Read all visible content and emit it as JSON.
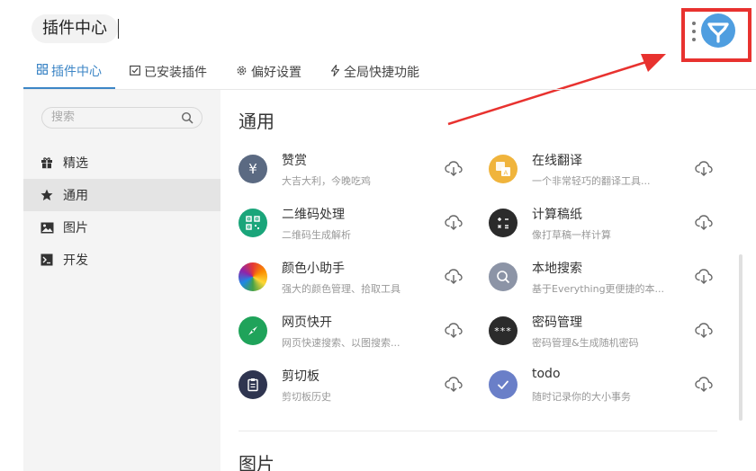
{
  "header": {
    "title": "插件中心"
  },
  "tabs": [
    {
      "icon": "grid-icon",
      "label": "插件中心",
      "active": true
    },
    {
      "icon": "installed-icon",
      "label": "已安装插件",
      "active": false
    },
    {
      "icon": "gear-icon",
      "label": "偏好设置",
      "active": false
    },
    {
      "icon": "lightning-icon",
      "label": "全局快捷功能",
      "active": false
    }
  ],
  "sidebar": {
    "search_placeholder": "搜索",
    "items": [
      {
        "icon": "gift-icon",
        "label": "精选"
      },
      {
        "icon": "star-icon",
        "label": "通用"
      },
      {
        "icon": "image-icon",
        "label": "图片"
      },
      {
        "icon": "terminal-icon",
        "label": "开发"
      }
    ]
  },
  "main": {
    "section_1": "通用",
    "section_2": "图片",
    "plugins": [
      {
        "name": "赞赏",
        "desc": "大吉大利，今晚吃鸡",
        "icon": "yen-icon",
        "color": "#5b6a82",
        "glyph": "¥"
      },
      {
        "name": "在线翻译",
        "desc": "一个非常轻巧的翻译工具...",
        "icon": "translate-icon",
        "color": "#f0b43c",
        "glyph": ""
      },
      {
        "name": "二维码处理",
        "desc": "二维码生成解析",
        "icon": "qrcode-icon",
        "color": "#1aa57a",
        "glyph": ""
      },
      {
        "name": "计算稿纸",
        "desc": "像打草稿一样计算",
        "icon": "calculator-icon",
        "color": "#2b2b2b",
        "glyph": ""
      },
      {
        "name": "颜色小助手",
        "desc": "强大的颜色管理、拾取工具",
        "icon": "color-wheel-icon",
        "color": "#e84040",
        "glyph": ""
      },
      {
        "name": "本地搜索",
        "desc": "基于Everything更便捷的本...",
        "icon": "local-search-icon",
        "color": "#8c94a6",
        "glyph": ""
      },
      {
        "name": "网页快开",
        "desc": "网页快速搜索、以图搜索...",
        "icon": "compass-icon",
        "color": "#1fa35a",
        "glyph": ""
      },
      {
        "name": "密码管理",
        "desc": "密码管理&生成随机密码",
        "icon": "password-icon",
        "color": "#2b2b2b",
        "glyph": "***"
      },
      {
        "name": "剪切板",
        "desc": "剪切板历史",
        "icon": "clipboard-icon",
        "color": "#2f3550",
        "glyph": ""
      },
      {
        "name": "todo",
        "desc": "随时记录你的大小事务",
        "icon": "check-icon",
        "color": "#6a7fc8",
        "glyph": ""
      }
    ]
  }
}
